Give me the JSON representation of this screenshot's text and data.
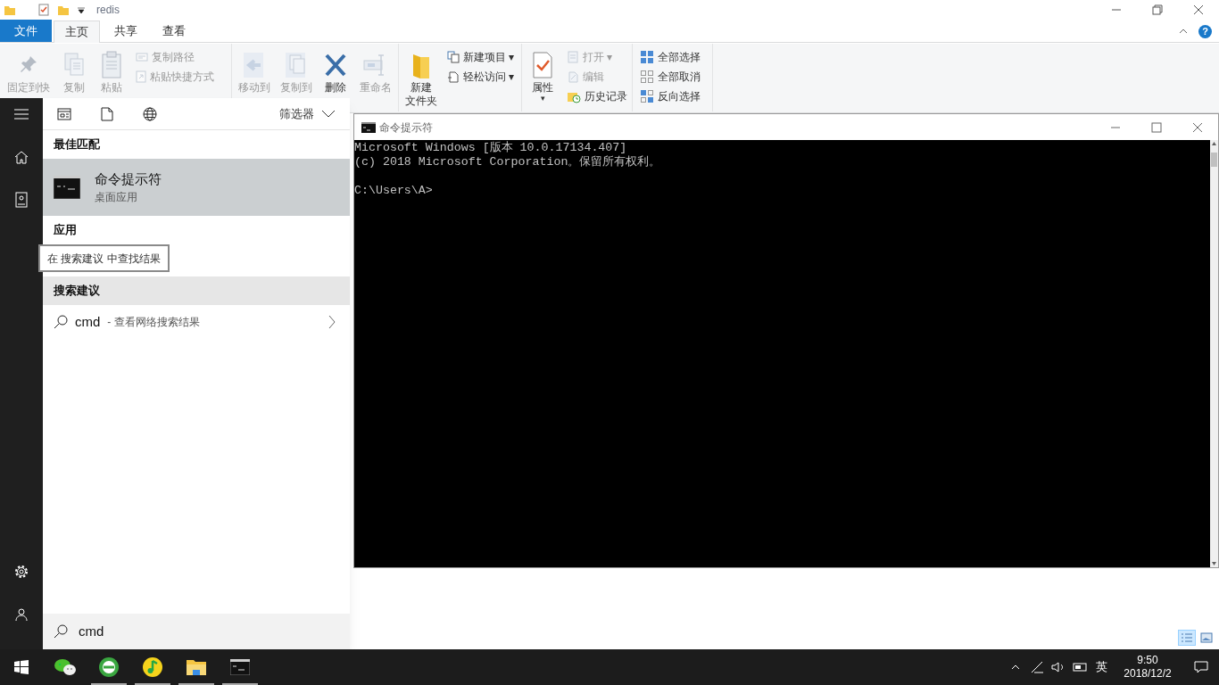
{
  "explorer": {
    "title": "redis",
    "tabs": [
      {
        "label": "文件",
        "kind": "file",
        "selected": false
      },
      {
        "label": "主页",
        "kind": "tab",
        "selected": true
      },
      {
        "label": "共享",
        "kind": "tab",
        "selected": false
      },
      {
        "label": "查看",
        "kind": "tab",
        "selected": false
      }
    ],
    "ribbon": [
      {
        "large": [
          {
            "label": "固定到快",
            "disabled": true
          },
          {
            "label": "复制",
            "disabled": true
          },
          {
            "label": "粘贴",
            "disabled": true
          }
        ],
        "small": [
          {
            "label": "复制路径",
            "disabled": true
          },
          {
            "label": "粘贴快捷方式",
            "disabled": true
          }
        ]
      },
      {
        "large": [
          {
            "label": "移动到",
            "disabled": true
          },
          {
            "label": "复制到",
            "disabled": true
          },
          {
            "label": "删除",
            "disabled": false
          },
          {
            "label": "重命名",
            "disabled": true
          }
        ]
      },
      {
        "large": [
          {
            "label": "新建",
            "label2": "文件夹",
            "disabled": false
          }
        ],
        "small": [
          {
            "label": "新建项目",
            "caret": "▾",
            "disabled": false
          },
          {
            "label": "轻松访问",
            "caret": "▾",
            "disabled": false
          }
        ]
      },
      {
        "large": [
          {
            "label": "属性",
            "caret": "▾",
            "disabled": false
          }
        ],
        "small": [
          {
            "label": "打开",
            "caret": "▾",
            "disabled": true
          },
          {
            "label": "编辑",
            "disabled": true
          },
          {
            "label": "历史记录",
            "disabled": false
          }
        ]
      },
      {
        "small": [
          {
            "label": "全部选择",
            "disabled": false
          },
          {
            "label": "全部取消",
            "disabled": false
          },
          {
            "label": "反向选择",
            "disabled": false
          }
        ]
      }
    ],
    "help": "?",
    "views": [
      {
        "kind": "details",
        "selected": true
      },
      {
        "kind": "large",
        "selected": false
      }
    ]
  },
  "search_panel": {
    "filter": "筛选器",
    "sections": [
      {
        "heading": "最佳匹配",
        "shaded": false,
        "results": [
          {
            "kind": "app",
            "title": "命令提示符",
            "subtitle": "桌面应用",
            "selected": true
          }
        ]
      },
      {
        "heading": "应用",
        "shaded": false
      },
      {
        "heading": "搜索建议",
        "shaded": true,
        "results": [
          {
            "kind": "web",
            "query": "cmd",
            "suffix": "- 查看网络搜索结果",
            "selected": false
          }
        ]
      }
    ],
    "tooltip": "在 搜索建议 中查找结果",
    "search_value": "cmd"
  },
  "cmd": {
    "title": "命令提示符",
    "lines": [
      "Microsoft Windows [版本 10.0.17134.407]",
      "(c) 2018 Microsoft Corporation。保留所有权利。"
    ],
    "prompt": "C:\\Users\\A>"
  },
  "taskbar": {
    "apps": [
      {
        "kind": "wechat",
        "running": false
      },
      {
        "kind": "browser",
        "running": true
      },
      {
        "kind": "music",
        "running": true
      },
      {
        "kind": "explorer",
        "running": true
      },
      {
        "kind": "cmd",
        "running": true
      }
    ],
    "ime": "英",
    "time": "9:50",
    "date": "2018/12/2"
  }
}
